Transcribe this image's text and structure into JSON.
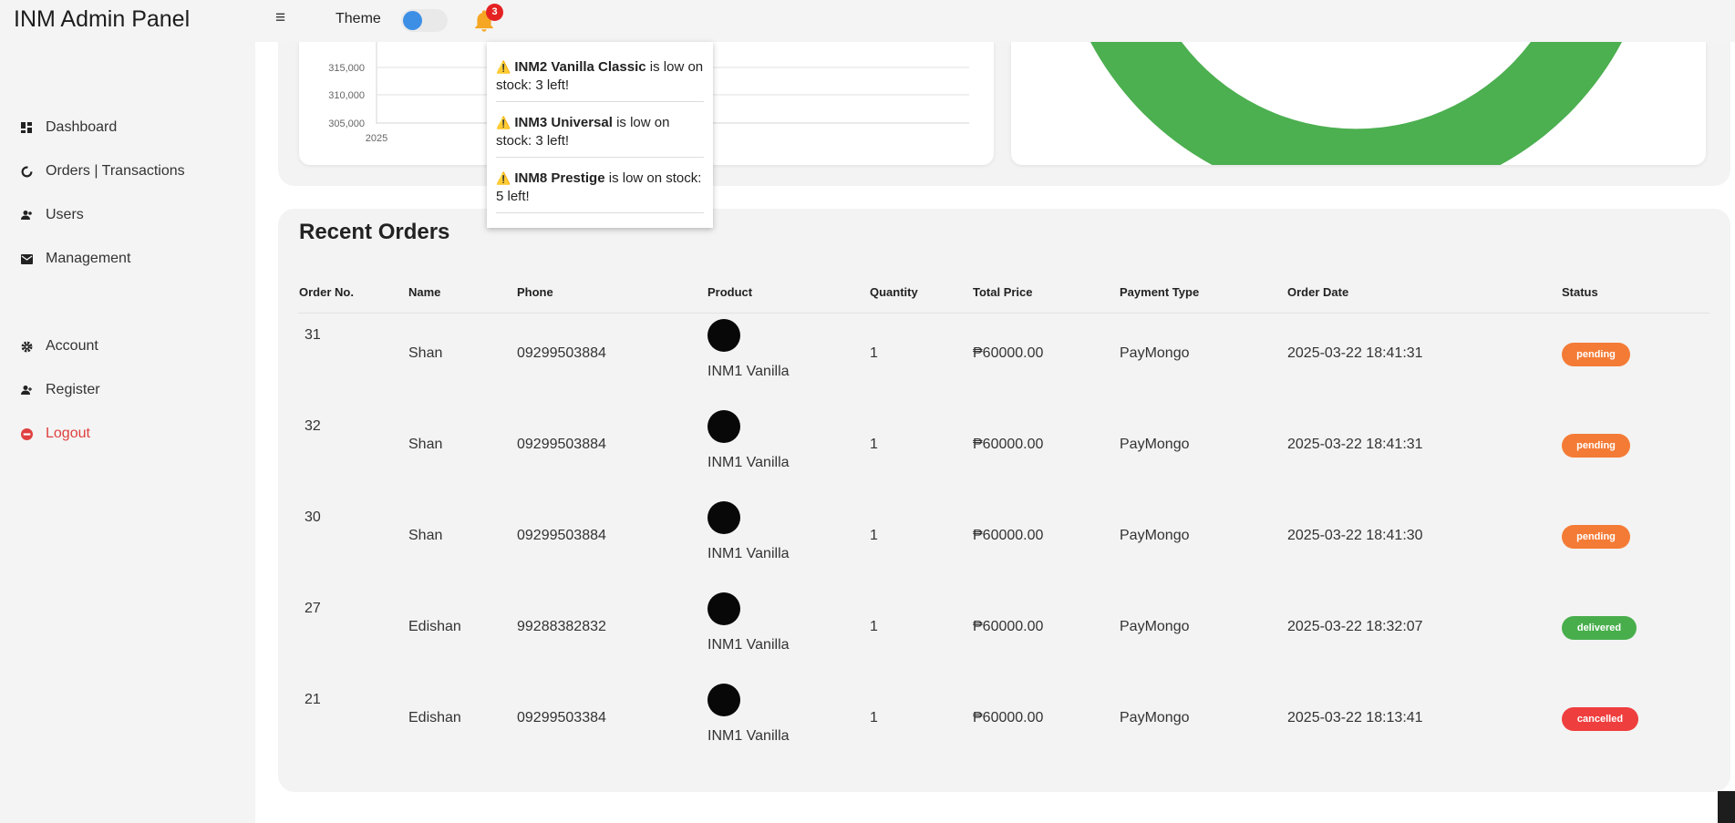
{
  "app": {
    "title": "INM Admin Panel"
  },
  "topbar": {
    "menu_icon": "hamburger-icon",
    "theme_label": "Theme",
    "theme_toggle_on": true,
    "notification_count": "3"
  },
  "sidebar": {
    "items": [
      {
        "label": "Dashboard",
        "icon": "dashboard-icon"
      },
      {
        "label": "Orders | Transactions",
        "icon": "orders-icon"
      },
      {
        "label": "Users",
        "icon": "users-icon"
      },
      {
        "label": "Management",
        "icon": "mail-icon"
      },
      {
        "label": "Account",
        "icon": "gear-icon"
      },
      {
        "label": "Register",
        "icon": "user-plus-icon"
      },
      {
        "label": "Logout",
        "icon": "logout-icon"
      }
    ]
  },
  "chart_data": {
    "type": "line",
    "x_tick_labels": [
      "2025"
    ],
    "y_tick_labels": [
      "315,000",
      "310,000",
      "305,000"
    ],
    "series": []
  },
  "notifications": [
    {
      "bold": "INM2 Vanilla Classic",
      "text": " is low on stock: 3 left!"
    },
    {
      "bold": "INM3 Universal",
      "text": " is low on stock: 3 left!"
    },
    {
      "bold": "INM8 Prestige",
      "text": " is low on stock: 5 left!"
    }
  ],
  "orders": {
    "title": "Recent Orders",
    "columns": [
      "Order No.",
      "Name",
      "Phone",
      "Product",
      "Quantity",
      "Total Price",
      "Payment Type",
      "Order Date",
      "Status"
    ],
    "rows": [
      {
        "order_no": "31",
        "name": "Shan",
        "phone": "09299503884",
        "product": "INM1 Vanilla",
        "quantity": "1",
        "total": "₱60000.00",
        "payment": "PayMongo",
        "date": "2025-03-22 18:41:31",
        "status": "pending"
      },
      {
        "order_no": "32",
        "name": "Shan",
        "phone": "09299503884",
        "product": "INM1 Vanilla",
        "quantity": "1",
        "total": "₱60000.00",
        "payment": "PayMongo",
        "date": "2025-03-22 18:41:31",
        "status": "pending"
      },
      {
        "order_no": "30",
        "name": "Shan",
        "phone": "09299503884",
        "product": "INM1 Vanilla",
        "quantity": "1",
        "total": "₱60000.00",
        "payment": "PayMongo",
        "date": "2025-03-22 18:41:30",
        "status": "pending"
      },
      {
        "order_no": "27",
        "name": "Edishan",
        "phone": "99288382832",
        "product": "INM1 Vanilla",
        "quantity": "1",
        "total": "₱60000.00",
        "payment": "PayMongo",
        "date": "2025-03-22 18:32:07",
        "status": "delivered"
      },
      {
        "order_no": "21",
        "name": "Edishan",
        "phone": "09299503384",
        "product": "INM1 Vanilla",
        "quantity": "1",
        "total": "₱60000.00",
        "payment": "PayMongo",
        "date": "2025-03-22 18:13:41",
        "status": "cancelled"
      }
    ]
  },
  "colors": {
    "pending": "#f47b35",
    "delivered": "#48ae4c",
    "cancelled": "#ef3e3e",
    "donut": "#4caf50",
    "toggle_knob": "#3d8fe6",
    "bell": "#f5a623",
    "logout": "#e04040"
  }
}
